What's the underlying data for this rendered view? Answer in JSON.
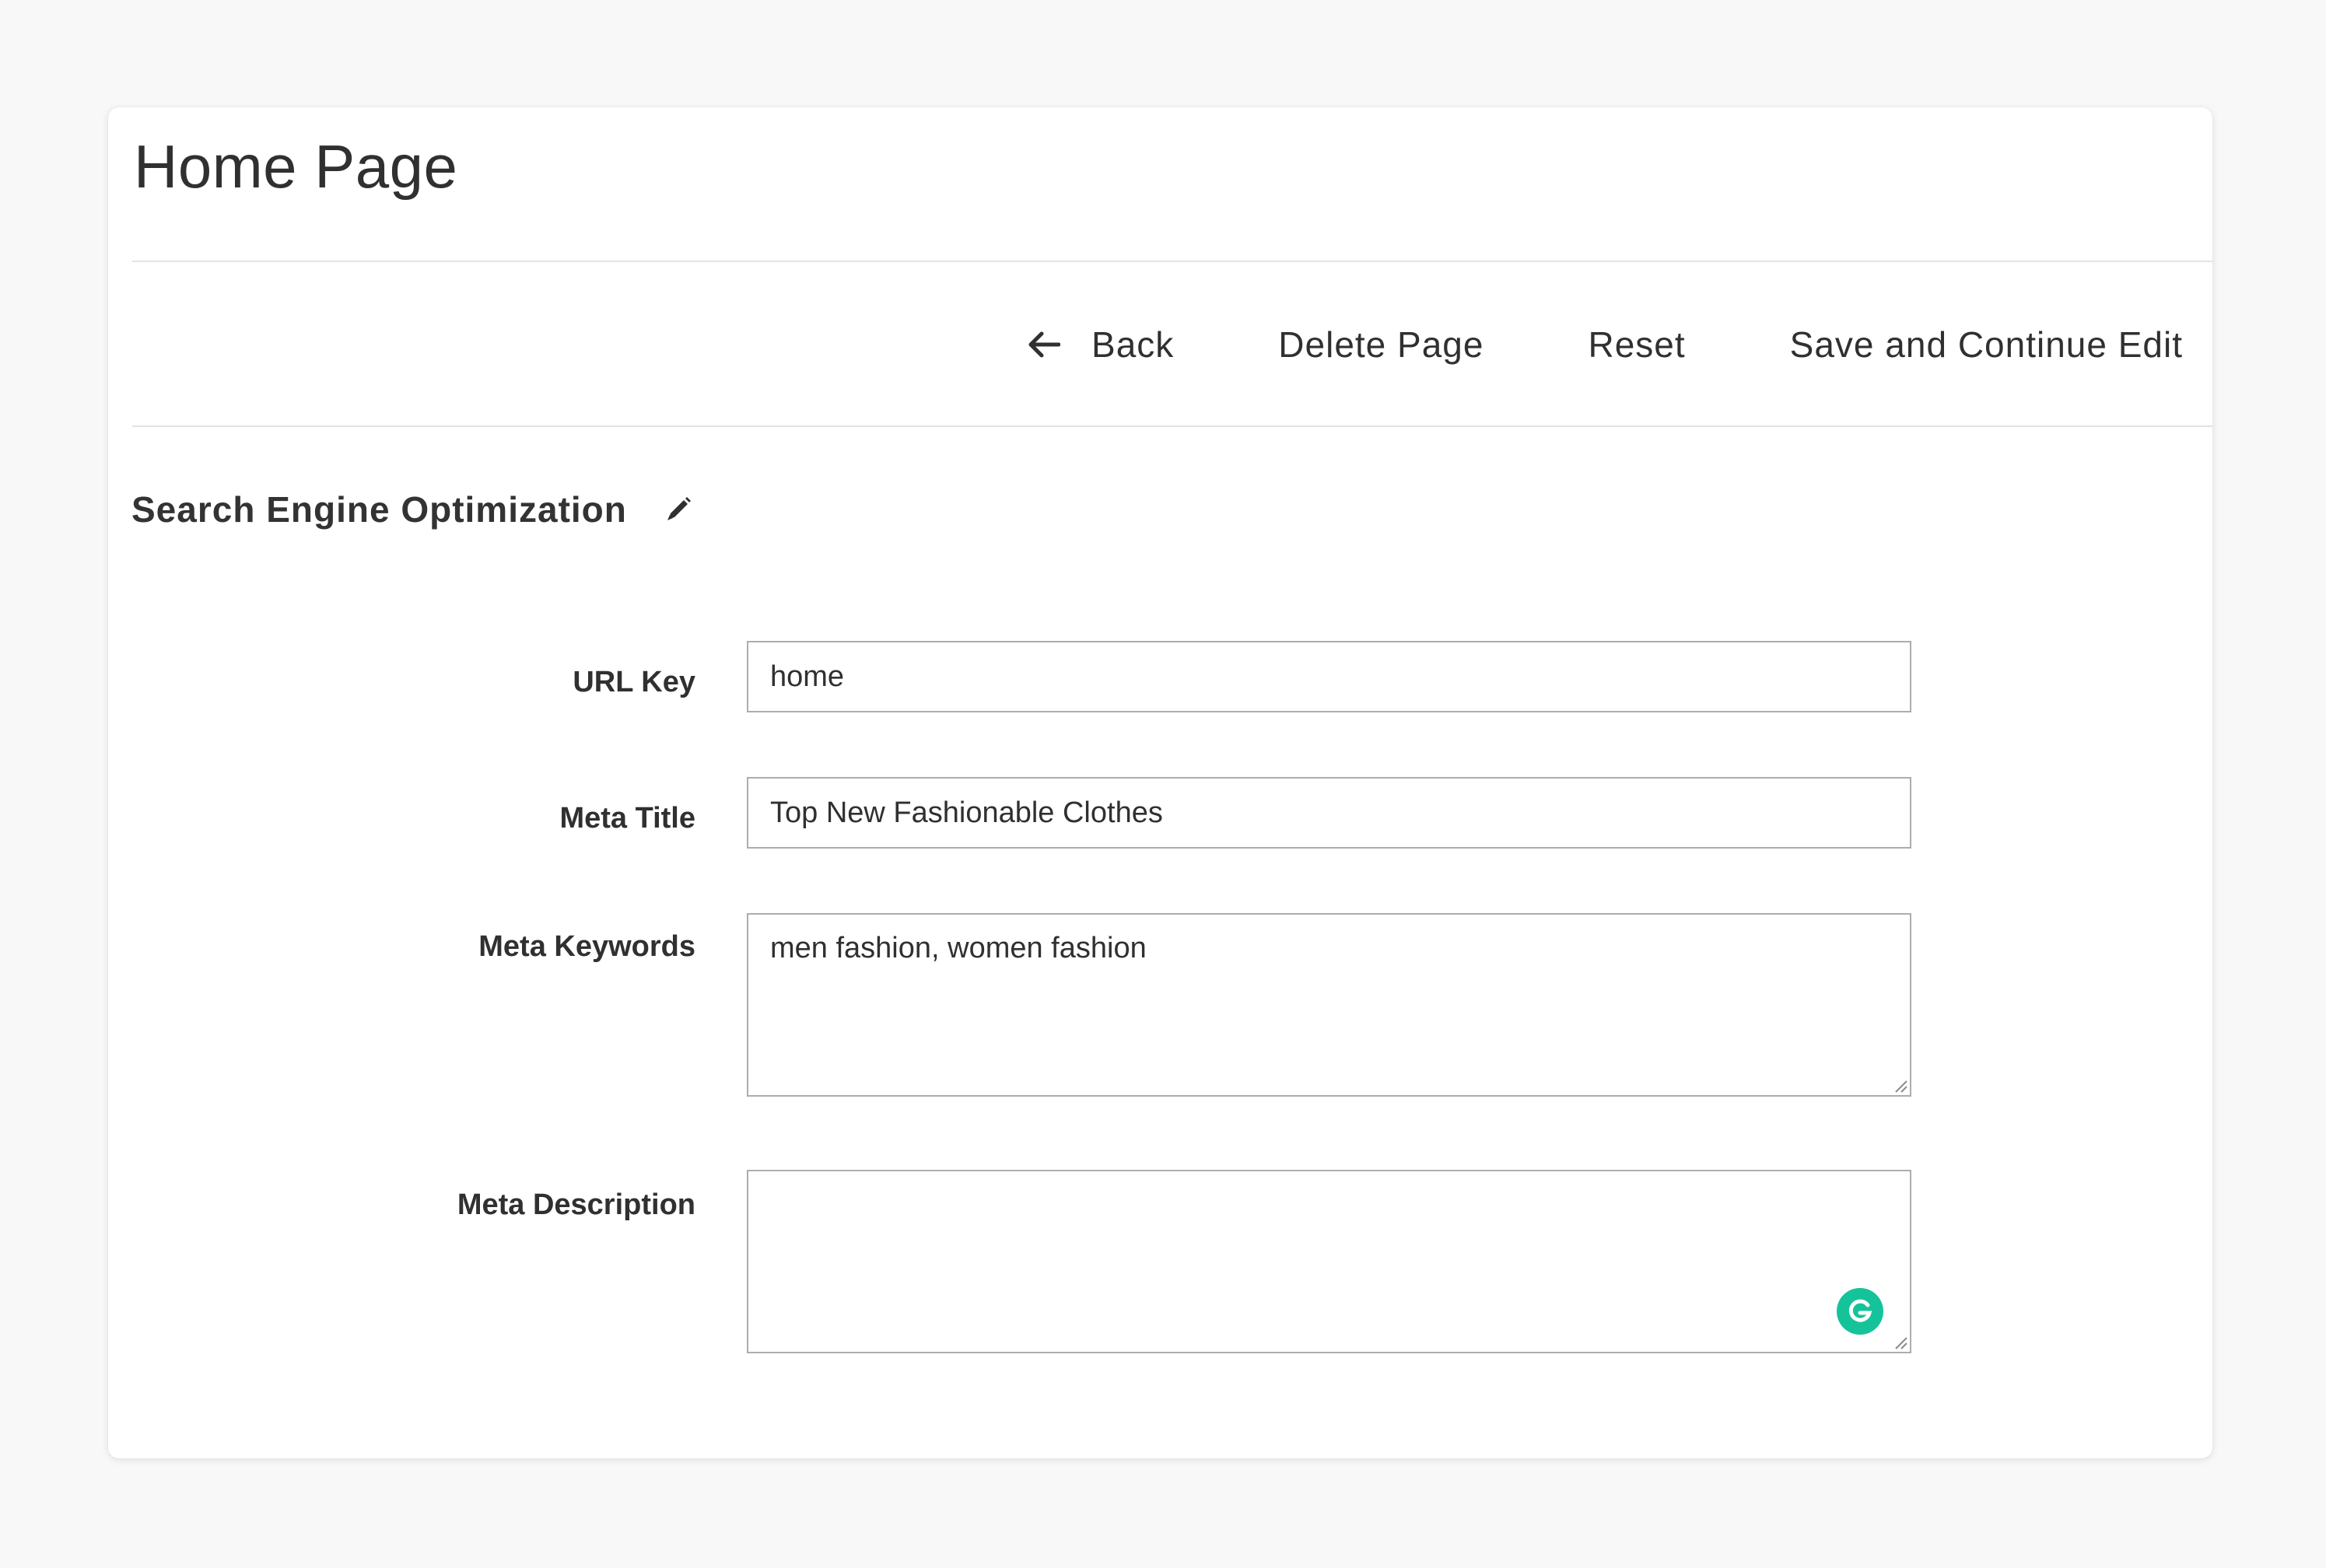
{
  "page": {
    "title": "Home Page"
  },
  "toolbar": {
    "back_label": "Back",
    "delete_label": "Delete Page",
    "reset_label": "Reset",
    "save_continue_label": "Save and Continue Edit"
  },
  "section": {
    "title": "Search Engine Optimization",
    "edit_icon": "pencil-icon"
  },
  "fields": {
    "url_key": {
      "label": "URL Key",
      "value": "home"
    },
    "meta_title": {
      "label": "Meta Title",
      "value": "Top New Fashionable Clothes"
    },
    "meta_keywords": {
      "label": "Meta Keywords",
      "value": "men fashion, women fashion"
    },
    "meta_description": {
      "label": "Meta Description",
      "value": ""
    }
  },
  "colors": {
    "background": "#f8f8f8",
    "card": "#ffffff",
    "input_border": "#adadad",
    "grammarly": "#15c39a"
  },
  "icons": {
    "back": "arrow-left-icon",
    "grammarly": "grammarly-icon",
    "resize": "resize-grip-icon"
  }
}
